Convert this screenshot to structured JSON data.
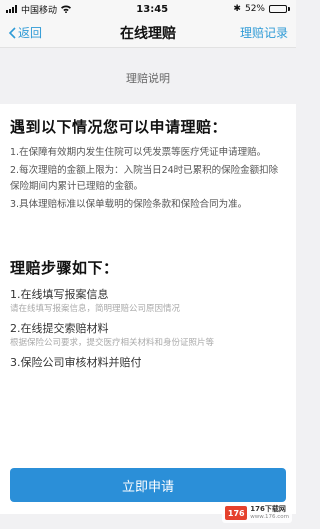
{
  "status_bar": {
    "carrier": "中国移动",
    "time": "13:45",
    "battery_percent": "52%",
    "battery_level": 0.52
  },
  "nav": {
    "back_label": "返回",
    "title": "在线理赔",
    "records_label": "理赔记录"
  },
  "section_header": "理赔说明",
  "conditions": {
    "heading": "遇到以下情况您可以申请理赔：",
    "items": [
      "1.在保障有效期内发生住院可以凭发票等医疗凭证申请理赔。",
      "2.每次理赔的金额上限为：入院当日24时已累积的保险金额扣除保险期间内累计已理赔的金额。",
      "3.具体理赔标准以保单载明的保险条款和保险合同为准。"
    ]
  },
  "steps": {
    "heading": "理赔步骤如下：",
    "items": [
      {
        "title": "1.在线填写报案信息",
        "desc": "请在线填写报案信息，简明理赔公司原因情况"
      },
      {
        "title": "2.在线提交索赔材料",
        "desc": "根据保险公司要求，提交医疗相关材料和身份证照片等"
      },
      {
        "title": "3.保险公司审核材料并赔付",
        "desc": ""
      }
    ]
  },
  "apply_button_label": "立即申请",
  "watermark": {
    "badge": "176",
    "line1": "176下载网",
    "line2": "www.176.com"
  },
  "colors": {
    "accent": "#2f9bd6",
    "button": "#2b8fd8"
  }
}
